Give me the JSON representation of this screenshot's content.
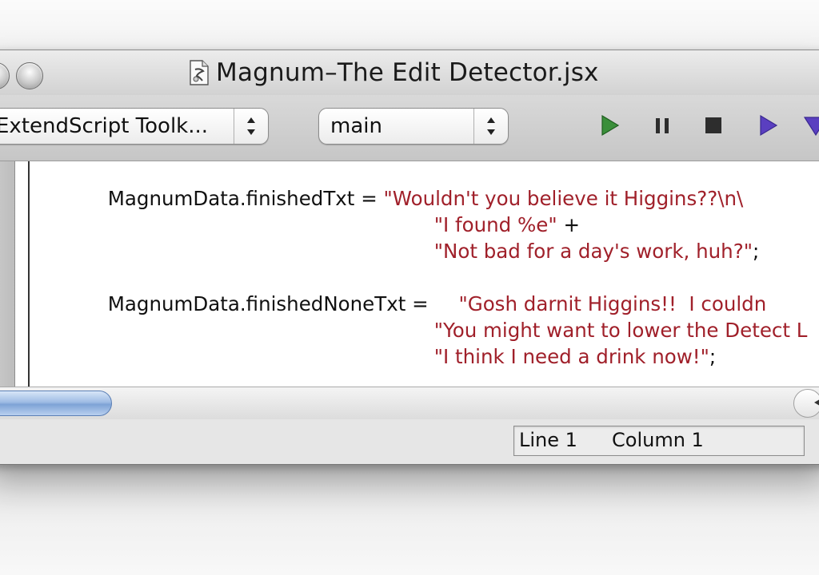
{
  "window": {
    "title": "Magnum–The Edit Detector.jsx"
  },
  "toolbar": {
    "target_app": "ExtendScript Toolk...",
    "function": "main",
    "colors": {
      "run": "#3a8f3a",
      "step": "#5a3fc0"
    }
  },
  "code": {
    "lines": [
      {
        "ident": "MagnumData.finishedTxt = ",
        "str": "\"Wouldn't you believe it Higgins??\\n\\",
        "tail": ""
      },
      {
        "ident": "",
        "str": "\"I found %e\"",
        "tail": " +"
      },
      {
        "ident": "",
        "str": "\"Not bad for a day's work, huh?\"",
        "tail": ";"
      },
      {
        "ident": "MagnumData.finishedNoneTxt = ",
        "str": "\"Gosh darnit Higgins!!  I couldn",
        "tail": ""
      },
      {
        "ident": "",
        "str": "\"You might want to lower the Detect L",
        "tail": ""
      },
      {
        "ident": "",
        "str": "\"I think I need a drink now!\"",
        "tail": ";"
      }
    ]
  },
  "status": {
    "line": "Line 1",
    "column": "Column 1"
  }
}
